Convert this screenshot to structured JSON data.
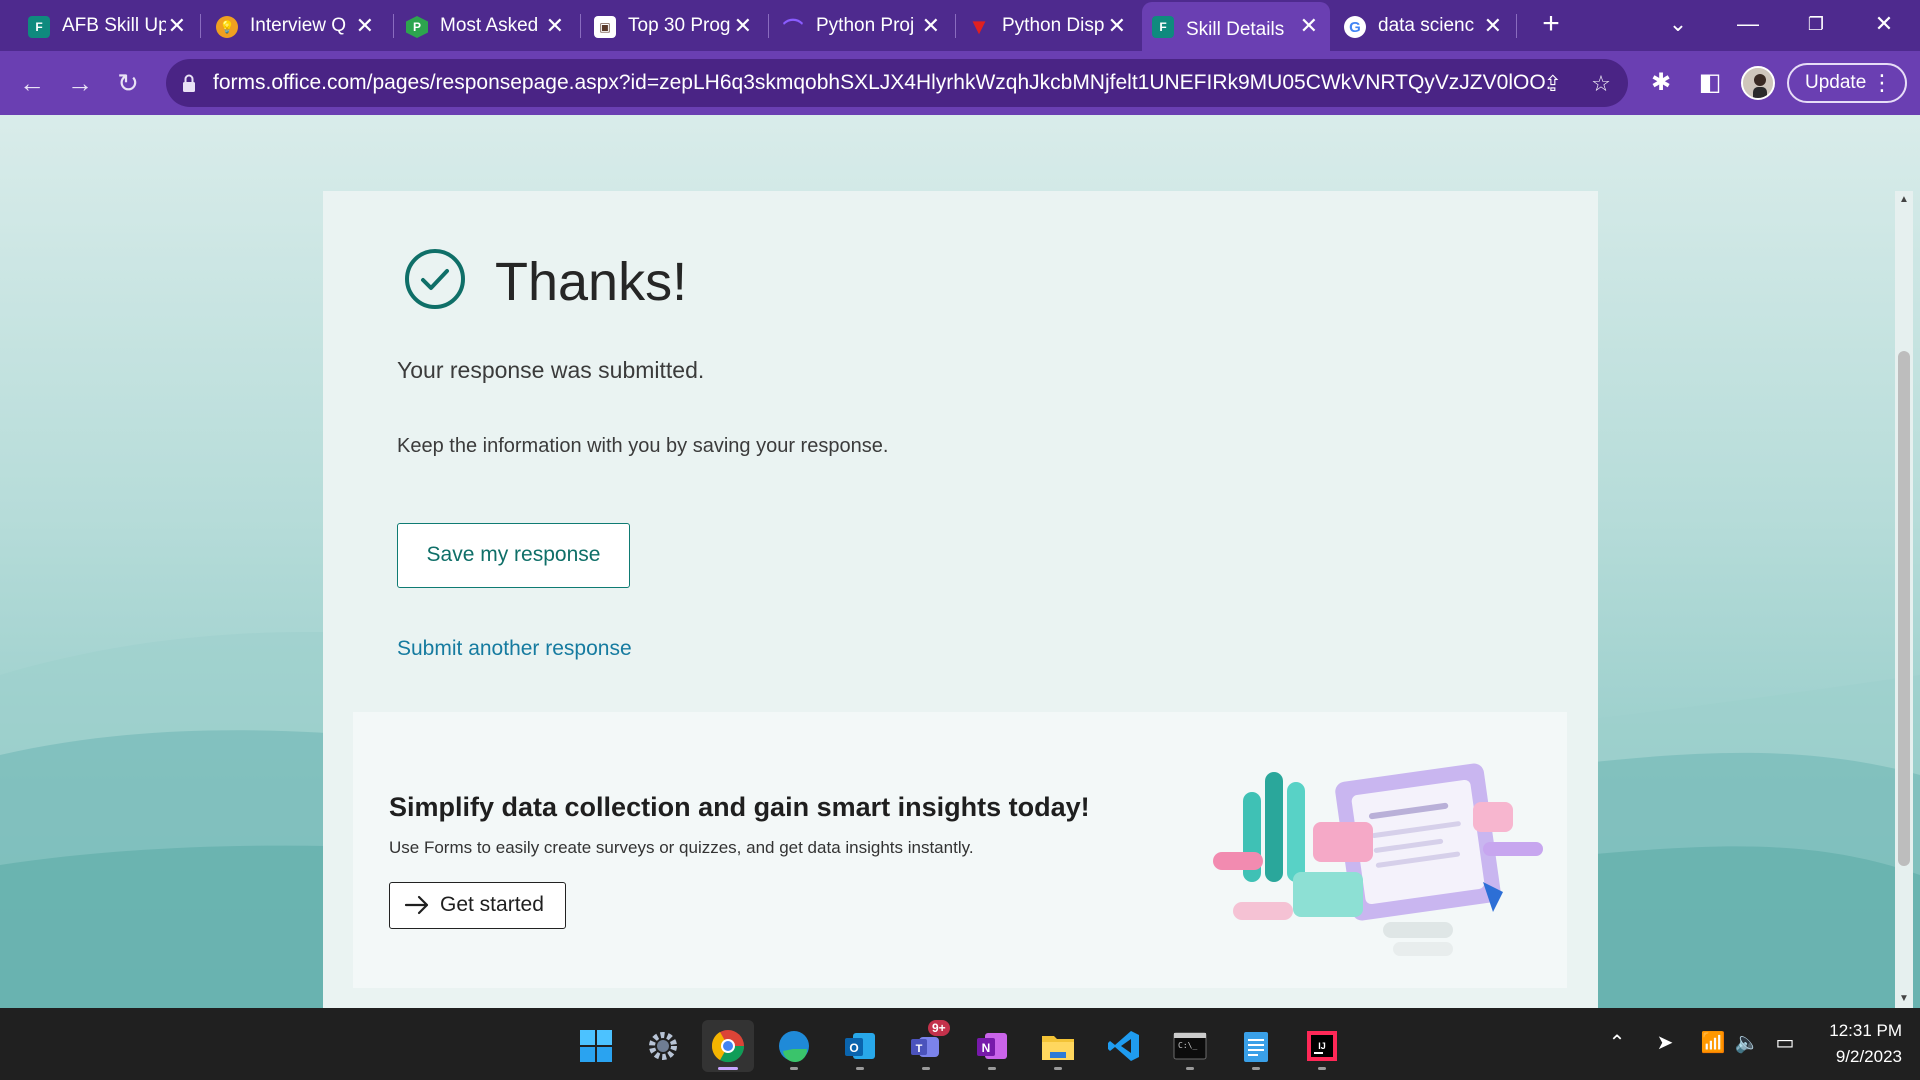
{
  "tabs": [
    {
      "label": "AFB Skill Up",
      "icon": "forms-icon",
      "color": "#0f8a7e"
    },
    {
      "label": "Interview Q",
      "icon": "bulb-icon",
      "color": "#f0a020"
    },
    {
      "label": "Most Asked",
      "icon": "hex-p-icon",
      "color": "#2da44e"
    },
    {
      "label": "Top 30 Prog",
      "icon": "cube-icon",
      "color": "#5a3a2a"
    },
    {
      "label": "Python Proj",
      "icon": "hat-icon",
      "color": "#7a3df0"
    },
    {
      "label": "Python Disp",
      "icon": "v-logo-icon",
      "color": "#e02020"
    },
    {
      "label": "Skill Details",
      "icon": "forms-icon",
      "color": "#0f8a7e"
    },
    {
      "label": "data scienc",
      "icon": "google-icon",
      "color": "#ffffff"
    }
  ],
  "address_bar": {
    "url": "forms.office.com/pages/responsepage.aspx?id=zepLH6q3skmqobhSXLJX4HlyrhkWzqhJkcbMNjfelt1UNEFIRk9MU05CWkVNRTQyVzJZV0lOO..."
  },
  "toolbar": {
    "update_label": "Update"
  },
  "confirmation": {
    "title": "Thanks!",
    "submitted": "Your response was submitted.",
    "keep_info": "Keep the information with you by saving your response.",
    "save_button": "Save my response",
    "another_link": "Submit another response"
  },
  "promo": {
    "title": "Simplify data collection and gain smart insights today!",
    "text": "Use Forms to easily create surveys or quizzes, and get data insights instantly.",
    "button": "Get started"
  },
  "taskbar": {
    "teams_badge": "9+",
    "time": "12:31 PM",
    "date": "9/2/2023"
  },
  "colors": {
    "browser_frame": "#4e2a8e",
    "toolbar": "#6a3fb2",
    "forms_accent": "#0f7b73",
    "link": "#167ba0"
  }
}
